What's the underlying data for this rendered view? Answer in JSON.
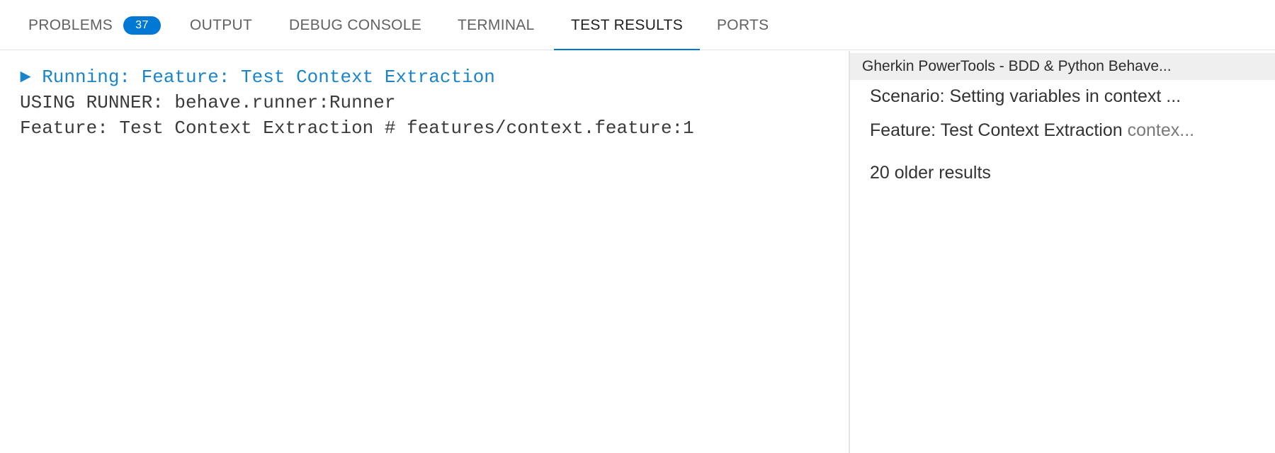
{
  "tabs": {
    "problems": {
      "label": "PROBLEMS",
      "badge": "37"
    },
    "output": {
      "label": "OUTPUT"
    },
    "debug_console": {
      "label": "DEBUG CONSOLE"
    },
    "terminal": {
      "label": "TERMINAL"
    },
    "test_results": {
      "label": "TEST RESULTS",
      "active": true
    },
    "ports": {
      "label": "PORTS"
    }
  },
  "output": {
    "lines": [
      "► Running: Feature: Test Context Extraction",
      "USING RUNNER: behave.runner:Runner",
      "Feature: Test Context Extraction # features/context.feature:1"
    ]
  },
  "results": {
    "header": "Gherkin PowerTools - BDD & Python Behave...",
    "items": [
      {
        "label": "Scenario: Setting variables in context ...",
        "description": ""
      },
      {
        "label": "Feature: Test Context Extraction",
        "description": "contex..."
      }
    ],
    "older": "20 older results"
  },
  "colors": {
    "accent": "#0078d4",
    "running_text": "#1a85c8"
  }
}
